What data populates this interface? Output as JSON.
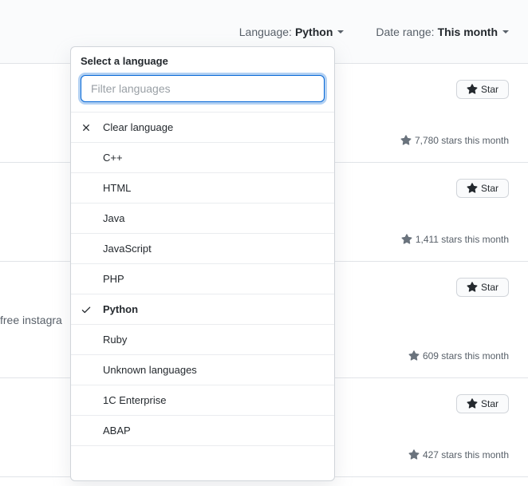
{
  "header": {
    "language_label": "Language:",
    "language_value": "Python",
    "date_label": "Date range:",
    "date_value": "This month"
  },
  "popup": {
    "title": "Select a language",
    "filter_placeholder": "Filter languages",
    "clear_label": "Clear language",
    "items": [
      {
        "label": "C++",
        "selected": false
      },
      {
        "label": "HTML",
        "selected": false
      },
      {
        "label": "Java",
        "selected": false
      },
      {
        "label": "JavaScript",
        "selected": false
      },
      {
        "label": "PHP",
        "selected": false
      },
      {
        "label": "Python",
        "selected": true
      },
      {
        "label": "Ruby",
        "selected": false
      },
      {
        "label": "Unknown languages",
        "selected": false
      },
      {
        "label": "1C Enterprise",
        "selected": false
      },
      {
        "label": "ABAP",
        "selected": false
      }
    ]
  },
  "repos": [
    {
      "star_label": "Star",
      "stars_text": "7,780 stars this month",
      "partial_text": ""
    },
    {
      "star_label": "Star",
      "stars_text": "1,411 stars this month",
      "partial_text": ""
    },
    {
      "star_label": "Star",
      "stars_text": "609 stars this month",
      "partial_text": "free instagra"
    },
    {
      "star_label": "Star",
      "stars_text": "427 stars this month",
      "partial_text": ""
    }
  ]
}
